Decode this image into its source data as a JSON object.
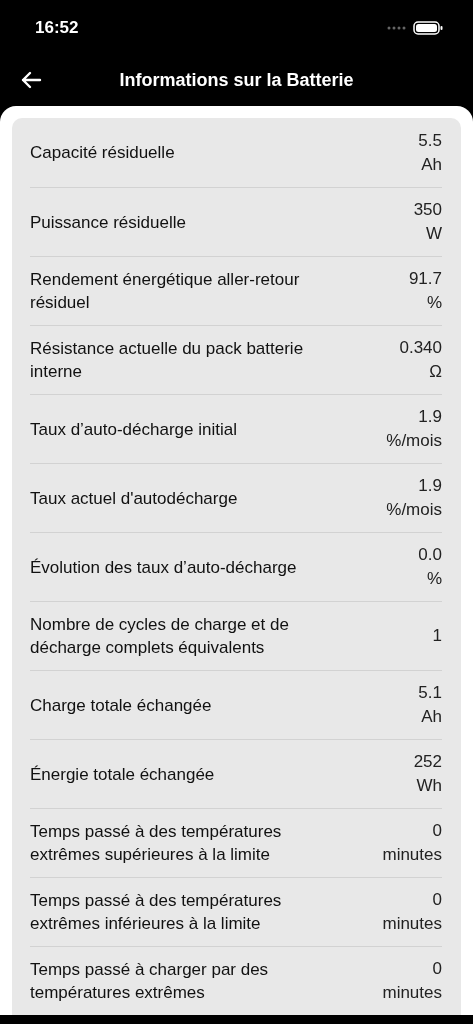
{
  "status_bar": {
    "time": "16:52"
  },
  "header": {
    "title": "Informations sur la Batterie"
  },
  "rows": [
    {
      "label": "Capacité résiduelle",
      "value": "5.5",
      "unit": "Ah"
    },
    {
      "label": "Puissance résiduelle",
      "value": "350",
      "unit": "W"
    },
    {
      "label": "Rendement énergétique aller-retour résiduel",
      "value": "91.7",
      "unit": "%"
    },
    {
      "label": "Résistance actuelle du pack batterie interne",
      "value": "0.340",
      "unit": "Ω"
    },
    {
      "label": "Taux d’auto-décharge initial",
      "value": "1.9",
      "unit": "%/mois"
    },
    {
      "label": "Taux actuel d'autodécharge",
      "value": "1.9",
      "unit": "%/mois"
    },
    {
      "label": "Évolution des taux d’auto-décharge",
      "value": "0.0",
      "unit": "%"
    },
    {
      "label": "Nombre de cycles de charge et de décharge complets équivalents",
      "value": "1"
    },
    {
      "label": "Charge totale échangée",
      "value": "5.1",
      "unit": "Ah"
    },
    {
      "label": "Énergie totale échangée",
      "value": "252",
      "unit": "Wh"
    },
    {
      "label": "Temps passé à des températures extrêmes supérieures à la limite",
      "value": "0",
      "unit": "minutes"
    },
    {
      "label": "Temps passé à des températures extrêmes inférieures à la limite",
      "value": "0",
      "unit": "minutes"
    },
    {
      "label": "Temps passé à charger par des températures extrêmes",
      "value": "0",
      "unit": "minutes"
    }
  ]
}
